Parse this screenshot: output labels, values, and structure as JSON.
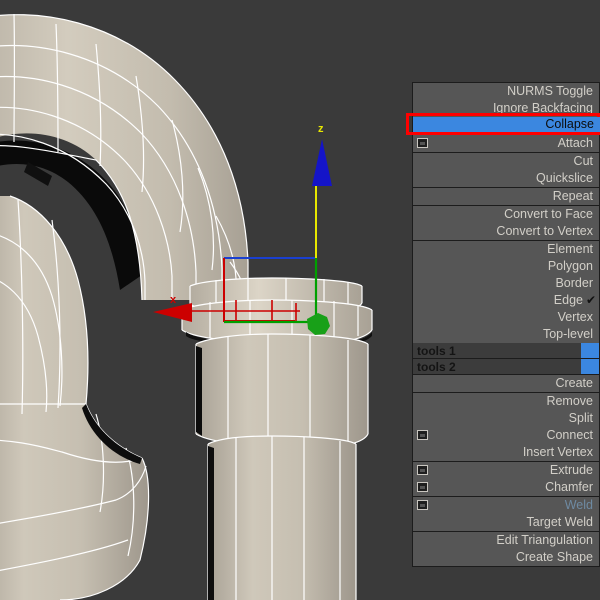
{
  "app": {
    "title": "3D modeling viewport with quad menu",
    "viewport_bg": "#3a3a3a",
    "mesh_color": "#c9c2b4",
    "wire_color": "#ffffff"
  },
  "viewport": {
    "gizmo": {
      "z_label": "z",
      "x_label": "x",
      "z_arrow_color": "#1414c8",
      "z_line_color": "#e8e800",
      "x_arrow_color": "#cc0000",
      "x_line_color": "#cc0000",
      "y_line_color": "#00a000",
      "plane_handle_color": "#1a3fd0",
      "origin_color": "#18a018",
      "z_label_color": "#e8e800",
      "x_label_color": "#cc0000"
    }
  },
  "quadmenu": {
    "highlight_box_color": "#fe0000",
    "selected_bg": "#3b87e0",
    "panel_bg": "#565656",
    "groups": [
      {
        "name": "group-subdivision",
        "items": [
          {
            "label": "NURMS Toggle",
            "box": false,
            "check": false,
            "state": "normal"
          },
          {
            "label": "Ignore Backfacing",
            "box": false,
            "check": false,
            "state": "normal"
          }
        ]
      },
      {
        "name": "group-edit",
        "items": [
          {
            "label": "Attach",
            "box": true,
            "check": false,
            "state": "normal"
          }
        ]
      },
      {
        "name": "group-cut",
        "items": [
          {
            "label": "Cut",
            "box": false,
            "check": false,
            "state": "normal"
          },
          {
            "label": "Quickslice",
            "box": false,
            "check": false,
            "state": "normal"
          }
        ]
      },
      {
        "name": "group-repeat",
        "items": [
          {
            "label": "Repeat",
            "box": false,
            "check": false,
            "state": "normal"
          }
        ]
      },
      {
        "name": "group-convert",
        "items": [
          {
            "label": "Convert to Face",
            "box": false,
            "check": false,
            "state": "normal"
          },
          {
            "label": "Convert to Vertex",
            "box": false,
            "check": false,
            "state": "normal"
          }
        ]
      },
      {
        "name": "group-subobject-level",
        "items": [
          {
            "label": "Element",
            "box": false,
            "check": false,
            "state": "normal"
          },
          {
            "label": "Polygon",
            "box": false,
            "check": false,
            "state": "normal"
          },
          {
            "label": "Border",
            "box": false,
            "check": false,
            "state": "normal"
          },
          {
            "label": "Edge",
            "box": false,
            "check": true,
            "state": "normal"
          },
          {
            "label": "Vertex",
            "box": false,
            "check": false,
            "state": "normal"
          },
          {
            "label": "Top-level",
            "box": false,
            "check": false,
            "state": "normal"
          }
        ]
      }
    ],
    "selected_item": {
      "label": "Collapse",
      "name": "collapse"
    },
    "tool_rows": [
      {
        "label": "tools 1"
      },
      {
        "label": "tools 2"
      }
    ],
    "groups_lower": [
      {
        "name": "group-create",
        "items": [
          {
            "label": "Create",
            "box": false,
            "check": false,
            "state": "normal"
          }
        ]
      },
      {
        "name": "group-modify",
        "items": [
          {
            "label": "Remove",
            "box": false,
            "check": false,
            "state": "normal"
          },
          {
            "label": "Split",
            "box": false,
            "check": false,
            "state": "normal"
          },
          {
            "label": "Connect",
            "box": true,
            "check": false,
            "state": "normal"
          },
          {
            "label": "Insert Vertex",
            "box": false,
            "check": false,
            "state": "normal"
          }
        ]
      },
      {
        "name": "group-extrude",
        "items": [
          {
            "label": "Extrude",
            "box": true,
            "check": false,
            "state": "normal"
          },
          {
            "label": "Chamfer",
            "box": true,
            "check": false,
            "state": "normal"
          }
        ]
      },
      {
        "name": "group-weld",
        "items": [
          {
            "label": "Weld",
            "box": true,
            "check": false,
            "state": "dim"
          },
          {
            "label": "Target Weld",
            "box": false,
            "check": false,
            "state": "normal"
          }
        ]
      },
      {
        "name": "group-misc",
        "items": [
          {
            "label": "Edit Triangulation",
            "box": false,
            "check": false,
            "state": "normal"
          },
          {
            "label": "Create Shape",
            "box": false,
            "check": false,
            "state": "normal"
          }
        ]
      }
    ],
    "check_glyph": "✔"
  }
}
